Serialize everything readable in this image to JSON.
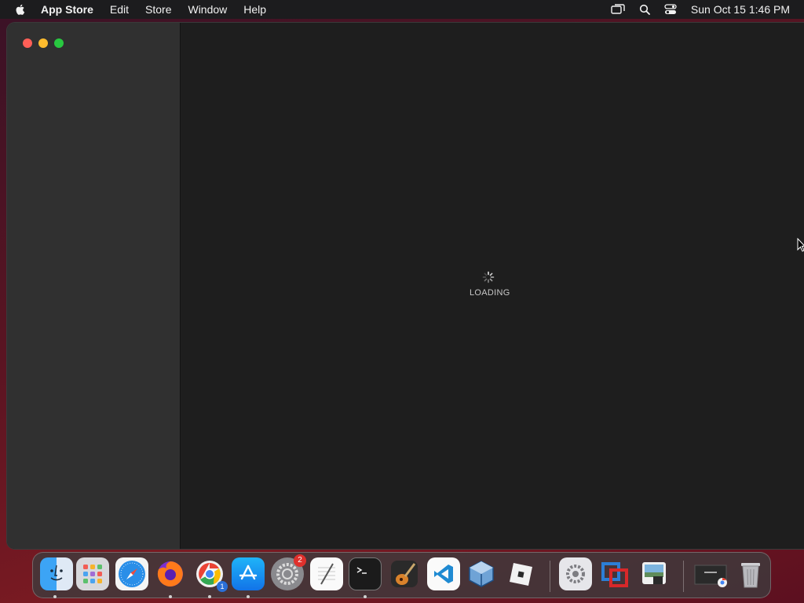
{
  "menubar": {
    "app_name": "App Store",
    "items": [
      "Edit",
      "Store",
      "Window",
      "Help"
    ],
    "clock": "Sun Oct 15  1:46 PM",
    "status_icons": [
      "screen-mirroring-icon",
      "search-icon",
      "control-center-icon"
    ]
  },
  "window": {
    "loading_label": "LOADING"
  },
  "dock": {
    "apps": [
      {
        "name": "Finder",
        "icon": "finder-icon",
        "running": true
      },
      {
        "name": "Launchpad",
        "icon": "launchpad-icon",
        "running": false
      },
      {
        "name": "Safari",
        "icon": "safari-icon",
        "running": false
      },
      {
        "name": "Firefox",
        "icon": "firefox-icon",
        "running": true
      },
      {
        "name": "Google Chrome",
        "icon": "chrome-icon",
        "running": true,
        "badge": "1"
      },
      {
        "name": "App Store",
        "icon": "app-store-icon",
        "running": true
      },
      {
        "name": "System Preferences",
        "icon": "system-preferences-icon",
        "running": false,
        "badge": "2"
      },
      {
        "name": "TextEdit",
        "icon": "textedit-icon",
        "running": false
      },
      {
        "name": "Terminal",
        "icon": "terminal-icon",
        "running": true
      },
      {
        "name": "GarageBand",
        "icon": "garageband-icon",
        "running": false
      },
      {
        "name": "Visual Studio Code",
        "icon": "vscode-icon",
        "running": false
      },
      {
        "name": "VirtualBox",
        "icon": "virtualbox-icon",
        "running": false
      },
      {
        "name": "Roblox",
        "icon": "roblox-icon",
        "running": false
      },
      {
        "name": "Settings",
        "icon": "settings-icon",
        "running": false
      },
      {
        "name": "Parallels",
        "icon": "parallels-icon",
        "running": false
      },
      {
        "name": "Preview",
        "icon": "preview-icon",
        "running": false
      },
      {
        "name": "Chrome Window",
        "icon": "chrome-window-thumbnail-icon",
        "running": false
      },
      {
        "name": "Trash",
        "icon": "trash-icon",
        "running": false
      }
    ]
  },
  "colors": {
    "close": "#ff5f57",
    "minimize": "#febc2e",
    "maximize": "#28c840"
  }
}
